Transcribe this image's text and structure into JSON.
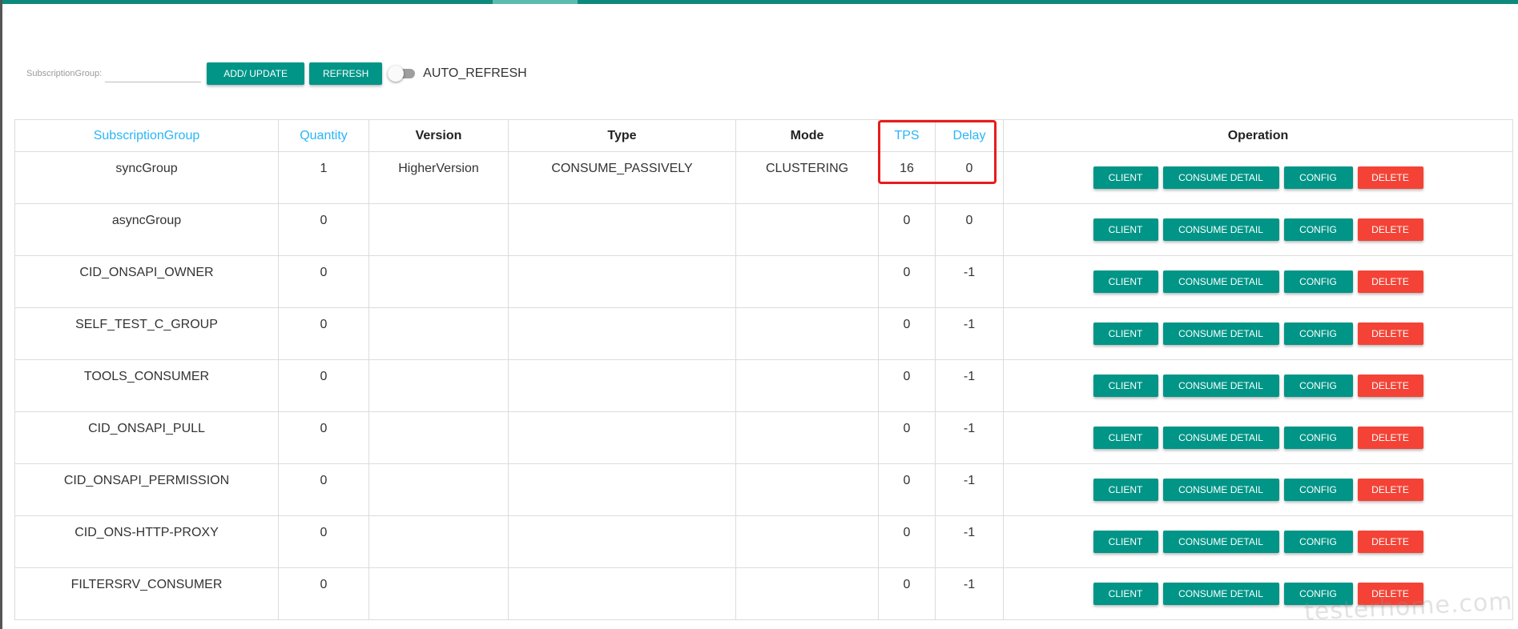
{
  "toolbar": {
    "filter_label": "SubscriptionGroup:",
    "filter_value": "",
    "add_update_label": "ADD/ UPDATE",
    "refresh_label": "REFRESH",
    "auto_refresh_label": "AUTO_REFRESH",
    "auto_refresh_on": false
  },
  "table": {
    "headers": {
      "group": "SubscriptionGroup",
      "quantity": "Quantity",
      "version": "Version",
      "type": "Type",
      "mode": "Mode",
      "tps": "TPS",
      "delay": "Delay",
      "operation": "Operation"
    },
    "rows": [
      {
        "group": "syncGroup",
        "quantity": "1",
        "version": "HigherVersion",
        "type": "CONSUME_PASSIVELY",
        "mode": "CLUSTERING",
        "tps": "16",
        "delay": "0"
      },
      {
        "group": "asyncGroup",
        "quantity": "0",
        "version": "",
        "type": "",
        "mode": "",
        "tps": "0",
        "delay": "0"
      },
      {
        "group": "CID_ONSAPI_OWNER",
        "quantity": "0",
        "version": "",
        "type": "",
        "mode": "",
        "tps": "0",
        "delay": "-1"
      },
      {
        "group": "SELF_TEST_C_GROUP",
        "quantity": "0",
        "version": "",
        "type": "",
        "mode": "",
        "tps": "0",
        "delay": "-1"
      },
      {
        "group": "TOOLS_CONSUMER",
        "quantity": "0",
        "version": "",
        "type": "",
        "mode": "",
        "tps": "0",
        "delay": "-1"
      },
      {
        "group": "CID_ONSAPI_PULL",
        "quantity": "0",
        "version": "",
        "type": "",
        "mode": "",
        "tps": "0",
        "delay": "-1"
      },
      {
        "group": "CID_ONSAPI_PERMISSION",
        "quantity": "0",
        "version": "",
        "type": "",
        "mode": "",
        "tps": "0",
        "delay": "-1"
      },
      {
        "group": "CID_ONS-HTTP-PROXY",
        "quantity": "0",
        "version": "",
        "type": "",
        "mode": "",
        "tps": "0",
        "delay": "-1"
      },
      {
        "group": "FILTERSRV_CONSUMER",
        "quantity": "0",
        "version": "",
        "type": "",
        "mode": "",
        "tps": "0",
        "delay": "-1"
      }
    ]
  },
  "row_actions": {
    "client": "CLIENT",
    "consume_detail": "CONSUME DETAIL",
    "config": "CONFIG",
    "delete": "DELETE"
  },
  "colors": {
    "primary": "#009587",
    "danger": "#f44336",
    "sortable_header": "#29b6f6",
    "top_bar": "#0d8a7b",
    "annotation": "#e81c1c"
  },
  "watermark": "testerhome.com"
}
